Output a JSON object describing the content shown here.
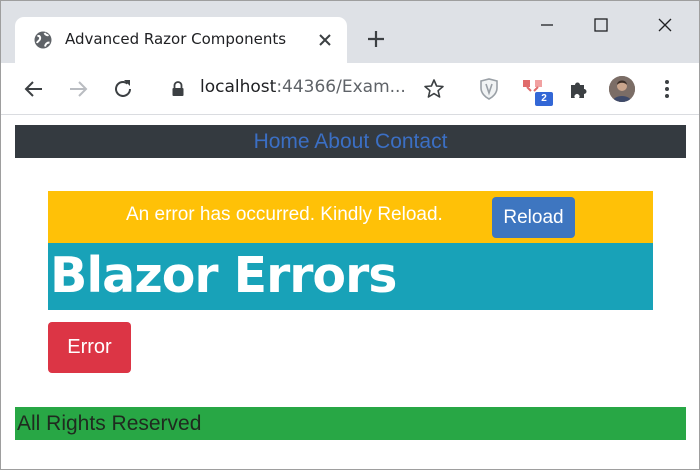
{
  "browser": {
    "tab": {
      "title": "Advanced Razor Components",
      "icon": "globe-icon"
    },
    "address": {
      "host": "localhost",
      "rest": ":44366/Exam..."
    },
    "extension_badge": "2",
    "icons": [
      "back-arrow-icon",
      "forward-arrow-icon",
      "reload-icon",
      "lock-icon",
      "star-icon",
      "shield-extension-icon",
      "extension-icon",
      "puzzle-icon",
      "avatar",
      "menu-dots-icon",
      "new-tab-icon",
      "minimize-icon",
      "maximize-icon",
      "close-window-icon"
    ]
  },
  "page": {
    "nav": {
      "home": "Home",
      "about": "About",
      "contact": "Contact"
    },
    "alert": {
      "message": "An error has occurred. Kindly Reload.",
      "reload_label": "Reload"
    },
    "heading": "Blazor Errors",
    "error_button_label": "Error",
    "footer_text": "All Rights Reserved"
  },
  "colors": {
    "navbar_bg": "#343a40",
    "nav_link": "#3b6fc4",
    "alert_bg": "#ffc107",
    "reload_btn": "#3e76c0",
    "heading_bg": "#18a2b8",
    "error_btn": "#dc3545",
    "footer_bg": "#28a745"
  }
}
